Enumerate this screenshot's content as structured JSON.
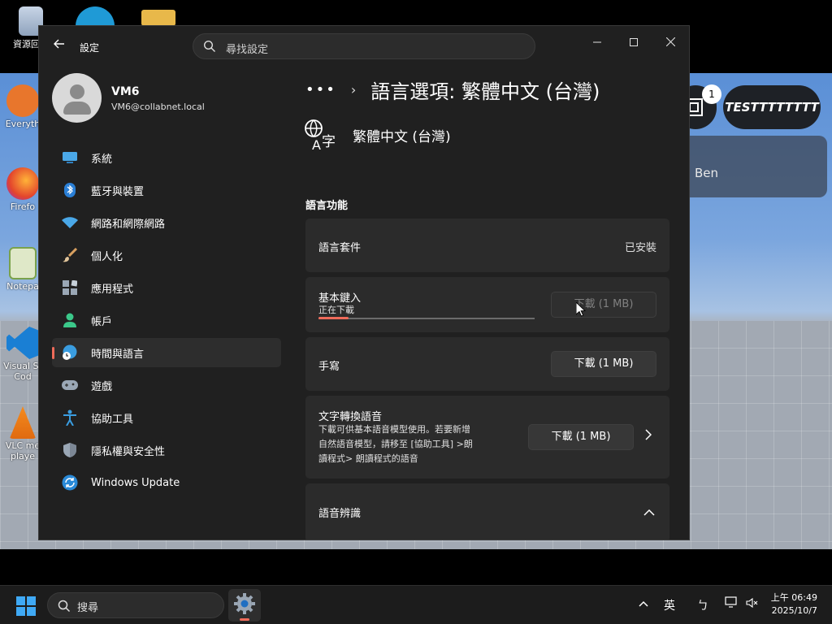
{
  "desktop": {
    "icons": [
      {
        "label": "資源回収"
      },
      {
        "label": "Everyth"
      },
      {
        "label": "Firefo"
      },
      {
        "label": "Notepa"
      },
      {
        "label": "Visual St"
      },
      {
        "label": "Cod"
      },
      {
        "label": "VLC me"
      },
      {
        "label": "playe"
      }
    ],
    "game": {
      "badge": "1",
      "pill_text": "TESTTTTTTTT",
      "panel_text": "Ben"
    }
  },
  "window": {
    "app_title": "設定",
    "search_placeholder": "尋找設定",
    "controls": {
      "minimize": "—",
      "maximize": "☐",
      "close": "✕"
    },
    "user": {
      "name": "VM6",
      "email": "VM6@collabnet.local"
    },
    "nav": [
      {
        "label": "系統",
        "icon": "monitor-icon"
      },
      {
        "label": "藍牙與裝置",
        "icon": "bluetooth-icon"
      },
      {
        "label": "網路和網際網路",
        "icon": "wifi-icon"
      },
      {
        "label": "個人化",
        "icon": "brush-icon"
      },
      {
        "label": "應用程式",
        "icon": "apps-icon"
      },
      {
        "label": "帳戶",
        "icon": "account-icon"
      },
      {
        "label": "時間與語言",
        "icon": "time-language-icon",
        "active": true
      },
      {
        "label": "遊戲",
        "icon": "gamepad-icon"
      },
      {
        "label": "協助工具",
        "icon": "accessibility-icon"
      },
      {
        "label": "隱私權與安全性",
        "icon": "shield-icon"
      },
      {
        "label": "Windows Update",
        "icon": "update-icon"
      }
    ],
    "breadcrumb": {
      "dots": "•••",
      "separator": "›",
      "title": "語言選項: 繁體中文 (台灣)"
    },
    "language_name": "繁體中文 (台灣)",
    "section_title": "語言功能",
    "features": {
      "pack": {
        "label": "語言套件",
        "status": "已安裝"
      },
      "basic_typing": {
        "label": "基本鍵入",
        "status": "正在下載",
        "button": "下載 (1 MB)",
        "progress": 0.14
      },
      "handwriting": {
        "label": "手寫",
        "button": "下載 (1 MB)"
      },
      "tts": {
        "label": "文字轉換語音",
        "description": [
          "下載可供基本語音模型使用。若要新增",
          "自然語音模型，請移至 [協助工具] >朗",
          "讀程式> 朗讀程式的語音"
        ],
        "button": "下載 (1 MB)"
      },
      "speech": {
        "label": "語音辨識"
      }
    }
  },
  "taskbar": {
    "search_text": "搜尋",
    "tray": {
      "chevron": "^",
      "ime": "英",
      "ime2": "ㄅ"
    },
    "clock": {
      "time": "上午 06:49",
      "date": "2025/10/7"
    }
  },
  "colors": {
    "accent": "#ef6b5a",
    "start": "#3fa9f5",
    "window_bg": "#202020",
    "card_bg": "#2b2b2b"
  }
}
